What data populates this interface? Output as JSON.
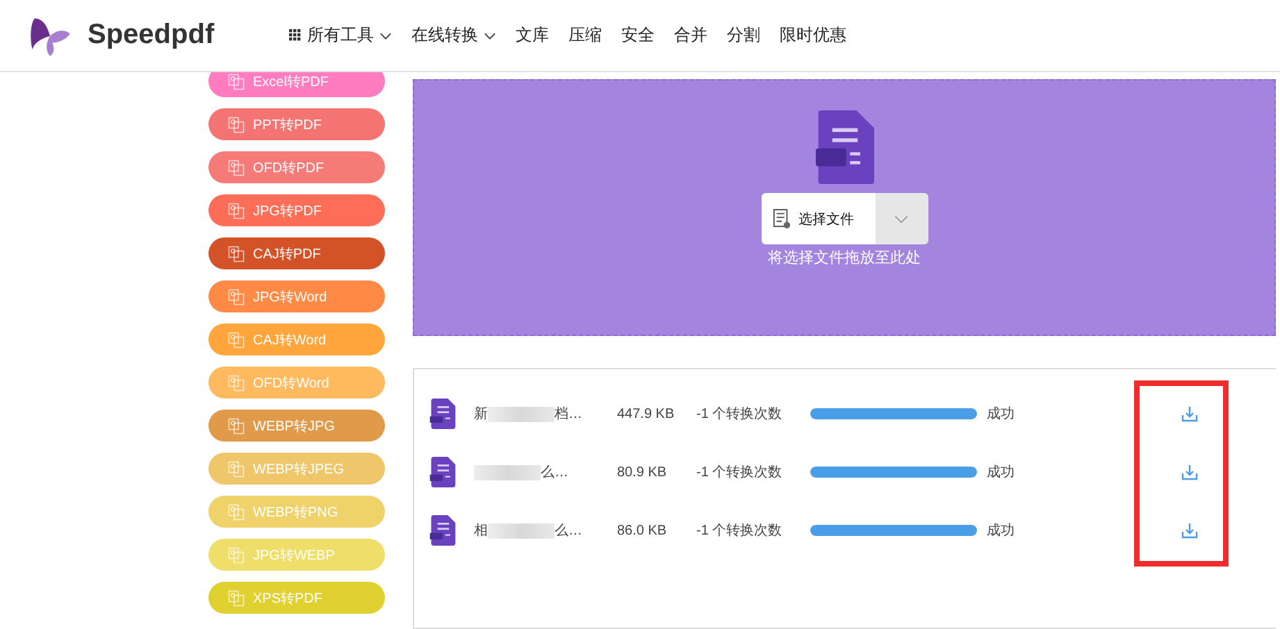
{
  "header": {
    "brand": "Speedpdf",
    "nav": [
      {
        "label": "所有工具",
        "kind": "grid-menu"
      },
      {
        "label": "在线转换",
        "kind": "menu"
      },
      {
        "label": "文库",
        "kind": "link"
      },
      {
        "label": "压缩",
        "kind": "link"
      },
      {
        "label": "安全",
        "kind": "link"
      },
      {
        "label": "合并",
        "kind": "link"
      },
      {
        "label": "分割",
        "kind": "link"
      },
      {
        "label": "限时优惠",
        "kind": "link"
      }
    ]
  },
  "sidebar": {
    "items": [
      {
        "label": "Excel转PDF",
        "color": "#ff7cc0"
      },
      {
        "label": "PPT转PDF",
        "color": "#f47474"
      },
      {
        "label": "OFD转PDF",
        "color": "#f67a78"
      },
      {
        "label": "JPG转PDF",
        "color": "#fd6e58"
      },
      {
        "label": "CAJ转PDF",
        "color": "#d35227"
      },
      {
        "label": "JPG转Word",
        "color": "#ff8a45"
      },
      {
        "label": "CAJ转Word",
        "color": "#ffa53c"
      },
      {
        "label": "OFD转Word",
        "color": "#ffba5f"
      },
      {
        "label": "WEBP转JPG",
        "color": "#e09a4a"
      },
      {
        "label": "WEBP转JPEG",
        "color": "#f0c66b"
      },
      {
        "label": "WEBP转PNG",
        "color": "#f0d26a"
      },
      {
        "label": "JPG转WEBP",
        "color": "#f0de6a"
      },
      {
        "label": "XPS转PDF",
        "color": "#e0d030"
      }
    ]
  },
  "upload": {
    "button": "选择文件",
    "hint": "将选择文件拖放至此处"
  },
  "files": [
    {
      "name_start": "新",
      "name_end": "档…",
      "size": "447.9 KB",
      "count": "-1 个转换次数",
      "level": 1,
      "status": "成功"
    },
    {
      "name_end": "么…",
      "size": "80.9 KB",
      "count": "-1 个转换次数",
      "level": 1,
      "status": "成功"
    },
    {
      "name_start": "相",
      "name_end": "么…",
      "size": "86.0 KB",
      "count": "-1 个转换次数",
      "level": 1,
      "status": "成功"
    }
  ]
}
